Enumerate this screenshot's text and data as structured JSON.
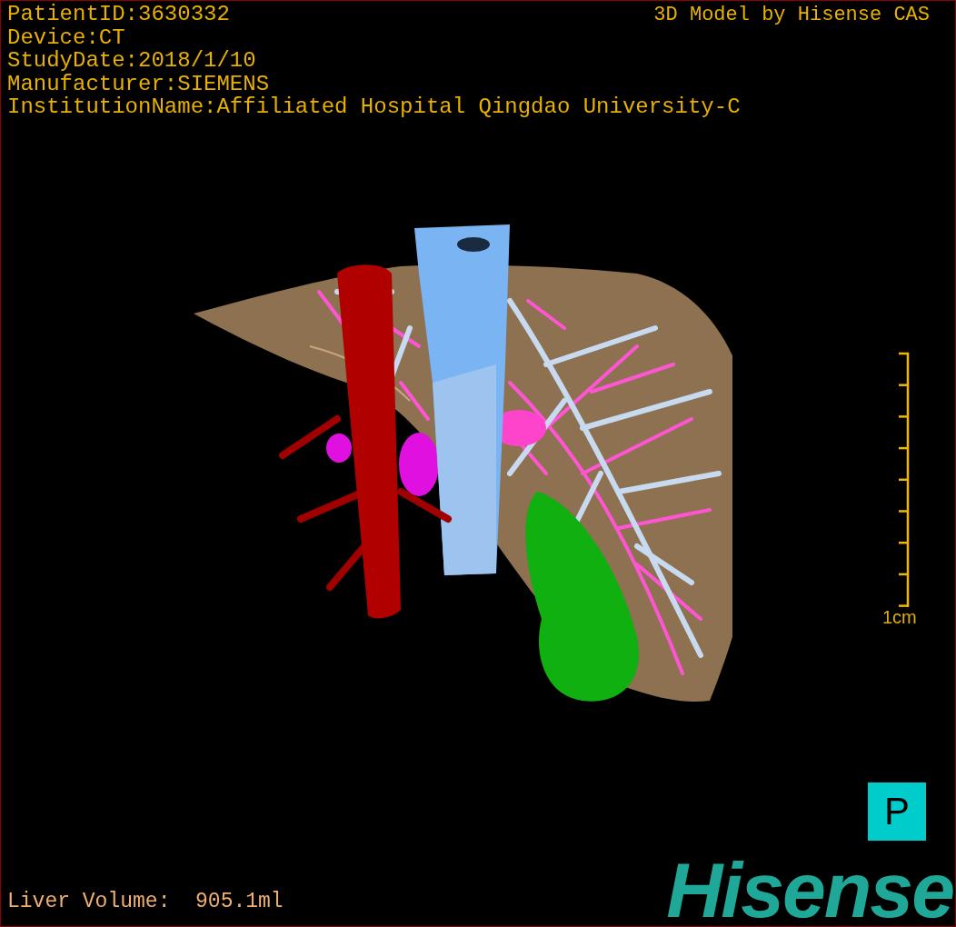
{
  "info_lines": [
    "PatientID:3630332",
    "Device:CT",
    "StudyDate:2018/1/10",
    "Manufacturer:SIEMENS",
    "InstitutionName:Affiliated Hospital Qingdao University-C"
  ],
  "header_right": "3D Model by Hisense CAS",
  "scale": {
    "label": "1cm"
  },
  "orientation_marker": "P",
  "measurement": "Liver Volume:  905.1ml",
  "logo": "Hisense"
}
